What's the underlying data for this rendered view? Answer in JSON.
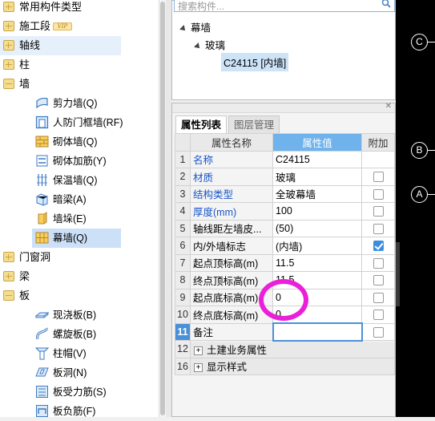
{
  "left_tree": {
    "top_items": [
      {
        "label": "常用构件类型"
      },
      {
        "label": "施工段",
        "badge": "VIP"
      },
      {
        "label": "轴线"
      },
      {
        "label": "柱"
      },
      {
        "label": "墙"
      },
      {
        "label": "门窗洞"
      },
      {
        "label": "梁"
      },
      {
        "label": "板"
      }
    ],
    "wall_children": [
      {
        "label": "剪力墙(Q)",
        "icon": "shear-wall-icon"
      },
      {
        "label": "人防门框墙(RF)",
        "icon": "civil-defense-door-frame-icon"
      },
      {
        "label": "砌体墙(Q)",
        "icon": "masonry-wall-icon"
      },
      {
        "label": "砌体加筋(Y)",
        "icon": "masonry-rebar-icon"
      },
      {
        "label": "保温墙(Q)",
        "icon": "insulation-wall-icon"
      },
      {
        "label": "暗梁(A)",
        "icon": "hidden-beam-icon"
      },
      {
        "label": "墙垛(E)",
        "icon": "wall-pier-icon"
      },
      {
        "label": "幕墙(Q)",
        "icon": "curtain-wall-icon"
      }
    ],
    "slab_children": [
      {
        "label": "现浇板(B)",
        "icon": "cast-slab-icon"
      },
      {
        "label": "螺旋板(B)",
        "icon": "spiral-slab-icon"
      },
      {
        "label": "柱帽(V)",
        "icon": "column-cap-icon"
      },
      {
        "label": "板洞(N)",
        "icon": "slab-hole-icon"
      },
      {
        "label": "板受力筋(S)",
        "icon": "slab-main-rebar-icon"
      },
      {
        "label": "板负筋(F)",
        "icon": "slab-negative-rebar-icon"
      }
    ]
  },
  "component_tree": {
    "search_placeholder": "搜索构件...",
    "root": "幕墙",
    "child": "玻璃",
    "leaf": "C24115 [内墙]"
  },
  "properties": {
    "tabs": [
      "属性列表",
      "图层管理"
    ],
    "headers": {
      "name": "属性名称",
      "value": "属性值",
      "extra": "附加"
    },
    "rows": [
      {
        "num": "1",
        "name": "名称",
        "value": "C24115",
        "blue": true,
        "checkbox": null
      },
      {
        "num": "2",
        "name": "材质",
        "value": "玻璃",
        "blue": true,
        "checkbox": false
      },
      {
        "num": "3",
        "name": "结构类型",
        "value": "全玻幕墙",
        "blue": true,
        "checkbox": false
      },
      {
        "num": "4",
        "name": "厚度(mm)",
        "value": "100",
        "blue": true,
        "checkbox": false
      },
      {
        "num": "5",
        "name": "轴线距左墙皮...",
        "value": "(50)",
        "blue": false,
        "checkbox": false
      },
      {
        "num": "6",
        "name": "内/外墙标志",
        "value": "(内墙)",
        "blue": false,
        "checkbox": true
      },
      {
        "num": "7",
        "name": "起点顶标高(m)",
        "value": "11.5",
        "blue": false,
        "checkbox": false
      },
      {
        "num": "8",
        "name": "终点顶标高(m)",
        "value": "11.5",
        "blue": false,
        "checkbox": false
      },
      {
        "num": "9",
        "name": "起点底标高(m)",
        "value": "0",
        "blue": false,
        "checkbox": false
      },
      {
        "num": "10",
        "name": "终点底标高(m)",
        "value": "0",
        "blue": false,
        "checkbox": false
      },
      {
        "num": "11",
        "name": "备注",
        "value": "",
        "blue": false,
        "checkbox": false
      }
    ],
    "groups": [
      {
        "num": "12",
        "label": "土建业务属性"
      },
      {
        "num": "16",
        "label": "显示样式"
      }
    ]
  },
  "canvas": {
    "axis_labels": [
      "C",
      "B",
      "A"
    ]
  },
  "colors": {
    "accent": "#4a90d9",
    "annotation": "#e91fd9",
    "link_blue": "#1a56c8"
  }
}
